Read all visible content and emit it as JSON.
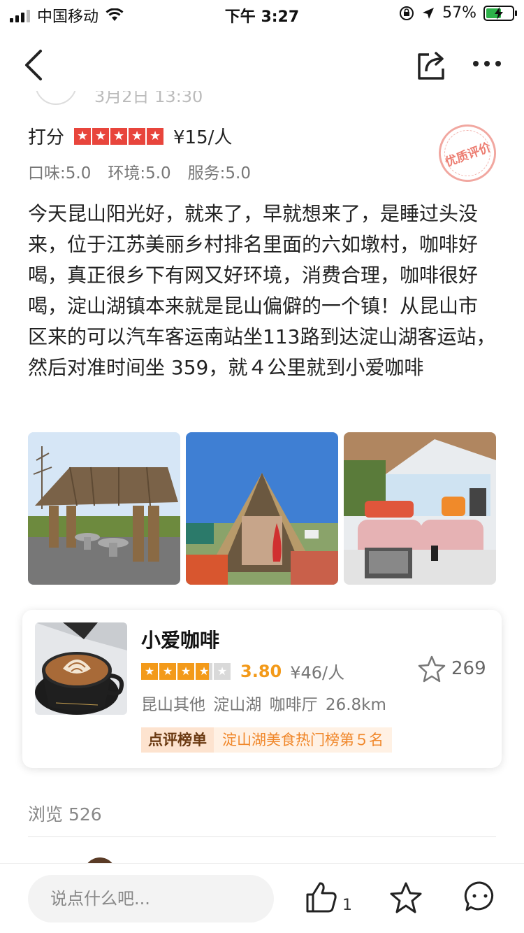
{
  "status_bar": {
    "carrier": "中国移动",
    "time": "下午 3:27",
    "battery_percent": "57%",
    "battery_level": 0.57,
    "accent_charging": "#2db24a"
  },
  "nav": {
    "back_icon": "chevron-left-icon",
    "share_icon": "share-icon",
    "more_icon": "more-icon"
  },
  "review": {
    "date_partial": "3月2日  13:30",
    "score_label": "打分",
    "rating_stars": 5,
    "price_per_person": "¥15/人",
    "badge": "优质评价",
    "sub_scores": {
      "taste": "口味:5.0",
      "environment": "环境:5.0",
      "service": "服务:5.0"
    },
    "text": "今天昆山阳光好，就来了，早就想来了，是睡过头没来，位于江苏美丽乡村排名里面的六如墩村，咖啡好喝，真正很乡下有网又好环境，消费合理，咖啡很好喝，淀山湖镇本来就是昆山偏僻的一个镇！从昆山市区来的可以汽车客运南站坐113路到达淀山湖客运站，然后对准时间坐 359，就４公里就到小爱咖啡",
    "photos": [
      "thatched-pavilion-photo",
      "a-frame-hut-photo",
      "cafe-interior-photo"
    ]
  },
  "shop": {
    "name": "小爱咖啡",
    "rating_value": 3.8,
    "rating_text": "3.80",
    "price": "¥46/人",
    "favorites": "269",
    "tags": "昆山其他  淀山湖  咖啡厅    26.8km",
    "rank_tag": "点评榜单",
    "rank_text": "淀山湖美食热门榜第５名",
    "accent": "#f39a1a"
  },
  "stats": {
    "views": "浏览 526"
  },
  "bottom_bar": {
    "comment_placeholder": "说点什么吧...",
    "like_count": "1"
  }
}
